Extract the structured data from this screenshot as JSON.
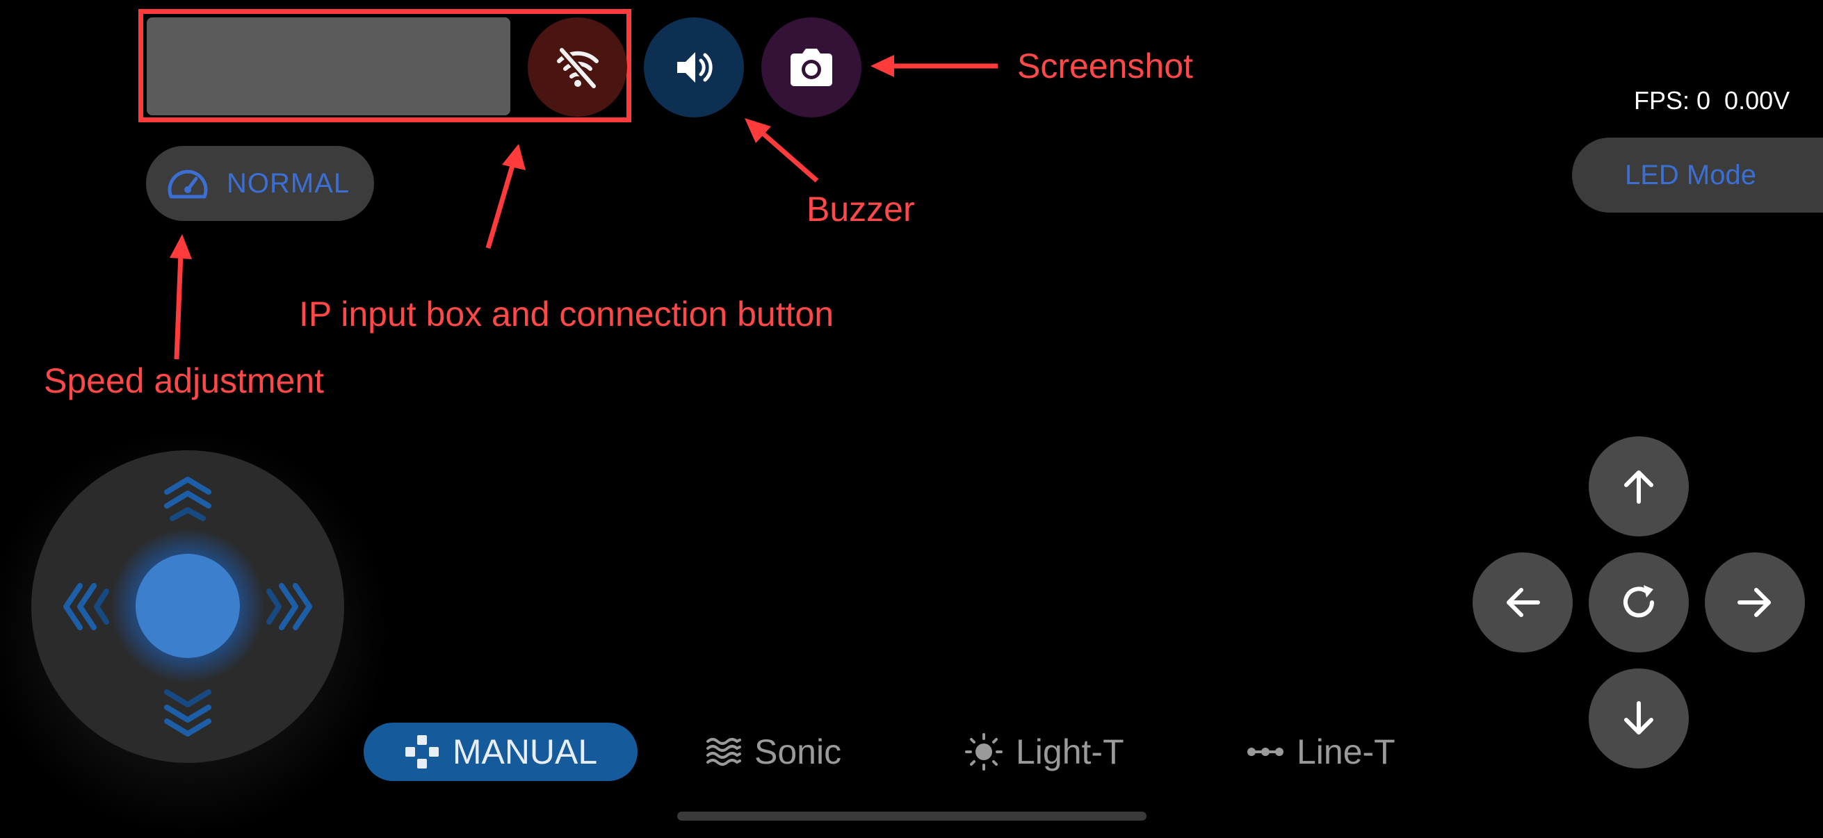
{
  "connection": {
    "ip_value": "",
    "ip_placeholder": "",
    "wifi_icon": "wifi-off-icon"
  },
  "top_buttons": {
    "buzzer_icon": "speaker-icon",
    "screenshot_icon": "camera-icon"
  },
  "speed": {
    "label": "NORMAL",
    "icon": "speedometer-icon"
  },
  "status": {
    "fps": "FPS: 0  0.00V"
  },
  "led": {
    "label": "LED Mode"
  },
  "annotations": {
    "screenshot": "Screenshot",
    "buzzer": "Buzzer",
    "ip_box": "IP input box and connection button",
    "speed": "Speed adjustment"
  },
  "modes": [
    {
      "label": "MANUAL",
      "icon": "gamepad-icon",
      "active": true
    },
    {
      "label": "Sonic",
      "icon": "waves-icon",
      "active": false
    },
    {
      "label": "Light-T",
      "icon": "sun-icon",
      "active": false
    },
    {
      "label": "Line-T",
      "icon": "line-dots-icon",
      "active": false
    }
  ],
  "colors": {
    "accent_blue": "#3b6fd4",
    "annotation_red": "#ff3b3b",
    "manual_bg": "#155b9c"
  }
}
